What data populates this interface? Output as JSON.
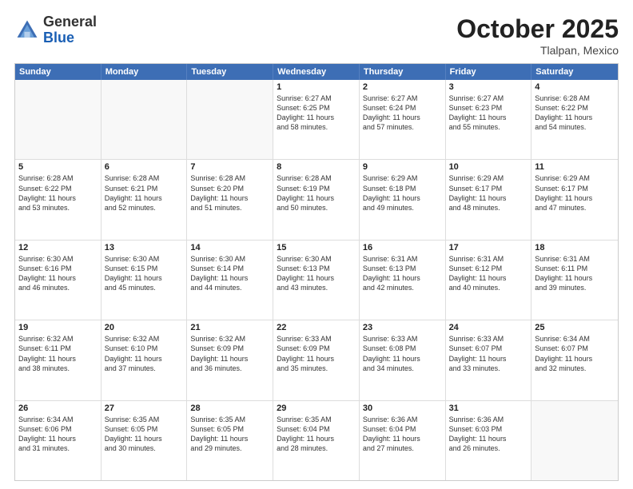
{
  "header": {
    "logo_general": "General",
    "logo_blue": "Blue",
    "month_title": "October 2025",
    "location": "Tlalpan, Mexico"
  },
  "weekdays": [
    "Sunday",
    "Monday",
    "Tuesday",
    "Wednesday",
    "Thursday",
    "Friday",
    "Saturday"
  ],
  "weeks": [
    [
      {
        "day": "",
        "info": "",
        "empty": true
      },
      {
        "day": "",
        "info": "",
        "empty": true
      },
      {
        "day": "",
        "info": "",
        "empty": true
      },
      {
        "day": "1",
        "info": "Sunrise: 6:27 AM\nSunset: 6:25 PM\nDaylight: 11 hours\nand 58 minutes.",
        "empty": false
      },
      {
        "day": "2",
        "info": "Sunrise: 6:27 AM\nSunset: 6:24 PM\nDaylight: 11 hours\nand 57 minutes.",
        "empty": false
      },
      {
        "day": "3",
        "info": "Sunrise: 6:27 AM\nSunset: 6:23 PM\nDaylight: 11 hours\nand 55 minutes.",
        "empty": false
      },
      {
        "day": "4",
        "info": "Sunrise: 6:28 AM\nSunset: 6:22 PM\nDaylight: 11 hours\nand 54 minutes.",
        "empty": false
      }
    ],
    [
      {
        "day": "5",
        "info": "Sunrise: 6:28 AM\nSunset: 6:22 PM\nDaylight: 11 hours\nand 53 minutes.",
        "empty": false
      },
      {
        "day": "6",
        "info": "Sunrise: 6:28 AM\nSunset: 6:21 PM\nDaylight: 11 hours\nand 52 minutes.",
        "empty": false
      },
      {
        "day": "7",
        "info": "Sunrise: 6:28 AM\nSunset: 6:20 PM\nDaylight: 11 hours\nand 51 minutes.",
        "empty": false
      },
      {
        "day": "8",
        "info": "Sunrise: 6:28 AM\nSunset: 6:19 PM\nDaylight: 11 hours\nand 50 minutes.",
        "empty": false
      },
      {
        "day": "9",
        "info": "Sunrise: 6:29 AM\nSunset: 6:18 PM\nDaylight: 11 hours\nand 49 minutes.",
        "empty": false
      },
      {
        "day": "10",
        "info": "Sunrise: 6:29 AM\nSunset: 6:17 PM\nDaylight: 11 hours\nand 48 minutes.",
        "empty": false
      },
      {
        "day": "11",
        "info": "Sunrise: 6:29 AM\nSunset: 6:17 PM\nDaylight: 11 hours\nand 47 minutes.",
        "empty": false
      }
    ],
    [
      {
        "day": "12",
        "info": "Sunrise: 6:30 AM\nSunset: 6:16 PM\nDaylight: 11 hours\nand 46 minutes.",
        "empty": false
      },
      {
        "day": "13",
        "info": "Sunrise: 6:30 AM\nSunset: 6:15 PM\nDaylight: 11 hours\nand 45 minutes.",
        "empty": false
      },
      {
        "day": "14",
        "info": "Sunrise: 6:30 AM\nSunset: 6:14 PM\nDaylight: 11 hours\nand 44 minutes.",
        "empty": false
      },
      {
        "day": "15",
        "info": "Sunrise: 6:30 AM\nSunset: 6:13 PM\nDaylight: 11 hours\nand 43 minutes.",
        "empty": false
      },
      {
        "day": "16",
        "info": "Sunrise: 6:31 AM\nSunset: 6:13 PM\nDaylight: 11 hours\nand 42 minutes.",
        "empty": false
      },
      {
        "day": "17",
        "info": "Sunrise: 6:31 AM\nSunset: 6:12 PM\nDaylight: 11 hours\nand 40 minutes.",
        "empty": false
      },
      {
        "day": "18",
        "info": "Sunrise: 6:31 AM\nSunset: 6:11 PM\nDaylight: 11 hours\nand 39 minutes.",
        "empty": false
      }
    ],
    [
      {
        "day": "19",
        "info": "Sunrise: 6:32 AM\nSunset: 6:11 PM\nDaylight: 11 hours\nand 38 minutes.",
        "empty": false
      },
      {
        "day": "20",
        "info": "Sunrise: 6:32 AM\nSunset: 6:10 PM\nDaylight: 11 hours\nand 37 minutes.",
        "empty": false
      },
      {
        "day": "21",
        "info": "Sunrise: 6:32 AM\nSunset: 6:09 PM\nDaylight: 11 hours\nand 36 minutes.",
        "empty": false
      },
      {
        "day": "22",
        "info": "Sunrise: 6:33 AM\nSunset: 6:09 PM\nDaylight: 11 hours\nand 35 minutes.",
        "empty": false
      },
      {
        "day": "23",
        "info": "Sunrise: 6:33 AM\nSunset: 6:08 PM\nDaylight: 11 hours\nand 34 minutes.",
        "empty": false
      },
      {
        "day": "24",
        "info": "Sunrise: 6:33 AM\nSunset: 6:07 PM\nDaylight: 11 hours\nand 33 minutes.",
        "empty": false
      },
      {
        "day": "25",
        "info": "Sunrise: 6:34 AM\nSunset: 6:07 PM\nDaylight: 11 hours\nand 32 minutes.",
        "empty": false
      }
    ],
    [
      {
        "day": "26",
        "info": "Sunrise: 6:34 AM\nSunset: 6:06 PM\nDaylight: 11 hours\nand 31 minutes.",
        "empty": false
      },
      {
        "day": "27",
        "info": "Sunrise: 6:35 AM\nSunset: 6:05 PM\nDaylight: 11 hours\nand 30 minutes.",
        "empty": false
      },
      {
        "day": "28",
        "info": "Sunrise: 6:35 AM\nSunset: 6:05 PM\nDaylight: 11 hours\nand 29 minutes.",
        "empty": false
      },
      {
        "day": "29",
        "info": "Sunrise: 6:35 AM\nSunset: 6:04 PM\nDaylight: 11 hours\nand 28 minutes.",
        "empty": false
      },
      {
        "day": "30",
        "info": "Sunrise: 6:36 AM\nSunset: 6:04 PM\nDaylight: 11 hours\nand 27 minutes.",
        "empty": false
      },
      {
        "day": "31",
        "info": "Sunrise: 6:36 AM\nSunset: 6:03 PM\nDaylight: 11 hours\nand 26 minutes.",
        "empty": false
      },
      {
        "day": "",
        "info": "",
        "empty": true
      }
    ]
  ]
}
